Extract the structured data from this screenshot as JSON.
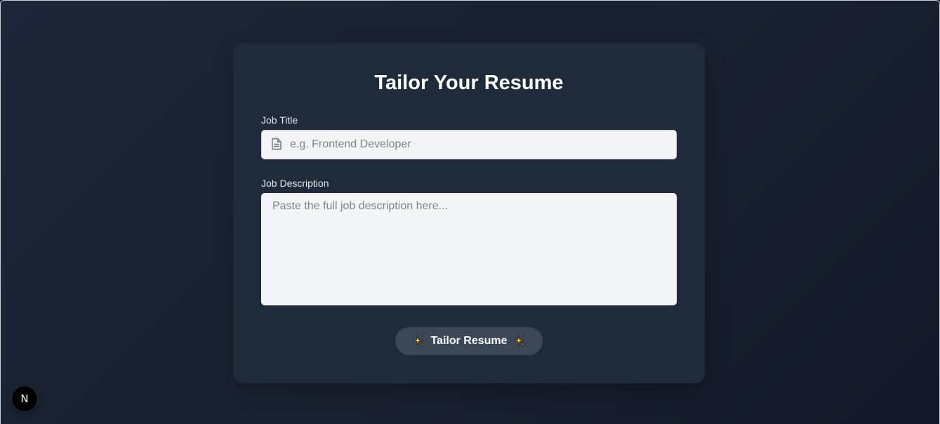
{
  "page": {
    "title": "Tailor Your Resume"
  },
  "form": {
    "job_title": {
      "label": "Job Title",
      "value": "",
      "placeholder": "e.g. Frontend Developer",
      "icon": "document-icon"
    },
    "job_description": {
      "label": "Job Description",
      "value": "",
      "placeholder": "Paste the full job description here..."
    },
    "submit": {
      "label": "Tailor Resume",
      "icon": "sparkles-icon"
    }
  },
  "dev_badge": {
    "letter": "N",
    "icon": "nextjs-logo-icon"
  },
  "colors": {
    "background": "#1a2231",
    "card": "#1f2a3b",
    "input_bg": "#f3f4f6",
    "button_bg": "#3b4657",
    "sparkle": "#f5c518"
  }
}
